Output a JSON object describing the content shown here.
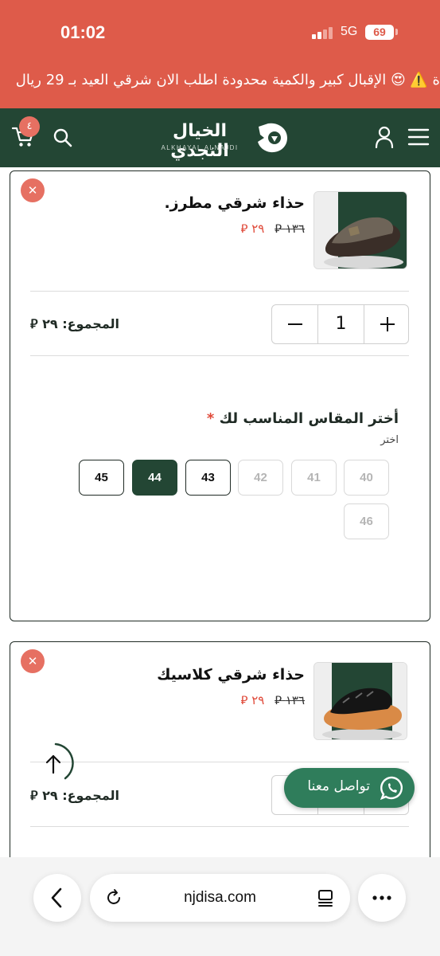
{
  "status_bar": {
    "time": "01:02",
    "network": "5G",
    "battery": "69"
  },
  "announcement": {
    "text": "ة ⚠️ 😍 الإقبال كبير والكمية محدودة اطلب الان شرقي العيد بـ 29 ريال"
  },
  "header": {
    "logo_ar": "الخيال النجدي",
    "logo_en": "ALKHAYAL ALNAJDI",
    "cart_count": "٤"
  },
  "cart": {
    "items": [
      {
        "name": "حذاء شرقي مطرز.",
        "price_old": "١٣٦",
        "price_new": "٢٩",
        "quantity": "1",
        "total_label": "المجموع:",
        "total_value": "٢٩"
      },
      {
        "name": "حذاء شرقي كلاسيك",
        "price_old": "١٣٦",
        "price_new": "٢٩",
        "total_label": "المجموع:",
        "total_value": "٢٩"
      }
    ]
  },
  "size_picker": {
    "title": "أختر المقاس المناسب لك",
    "required_mark": "*",
    "hint": "اختر",
    "options": [
      {
        "label": "40",
        "state": "disabled"
      },
      {
        "label": "41",
        "state": "disabled"
      },
      {
        "label": "42",
        "state": "disabled"
      },
      {
        "label": "43",
        "state": "available"
      },
      {
        "label": "44",
        "state": "selected"
      },
      {
        "label": "45",
        "state": "available"
      },
      {
        "label": "46",
        "state": "disabled"
      }
    ]
  },
  "whatsapp": {
    "label": "تواصل معنا"
  },
  "browser": {
    "url": "njdisa.com"
  },
  "colors": {
    "brand_green": "#234634",
    "announcement_bg": "#de5b4a",
    "sale_red": "#e04a3a",
    "close_red": "#e67062",
    "whatsapp_green": "#2f7d5b"
  }
}
